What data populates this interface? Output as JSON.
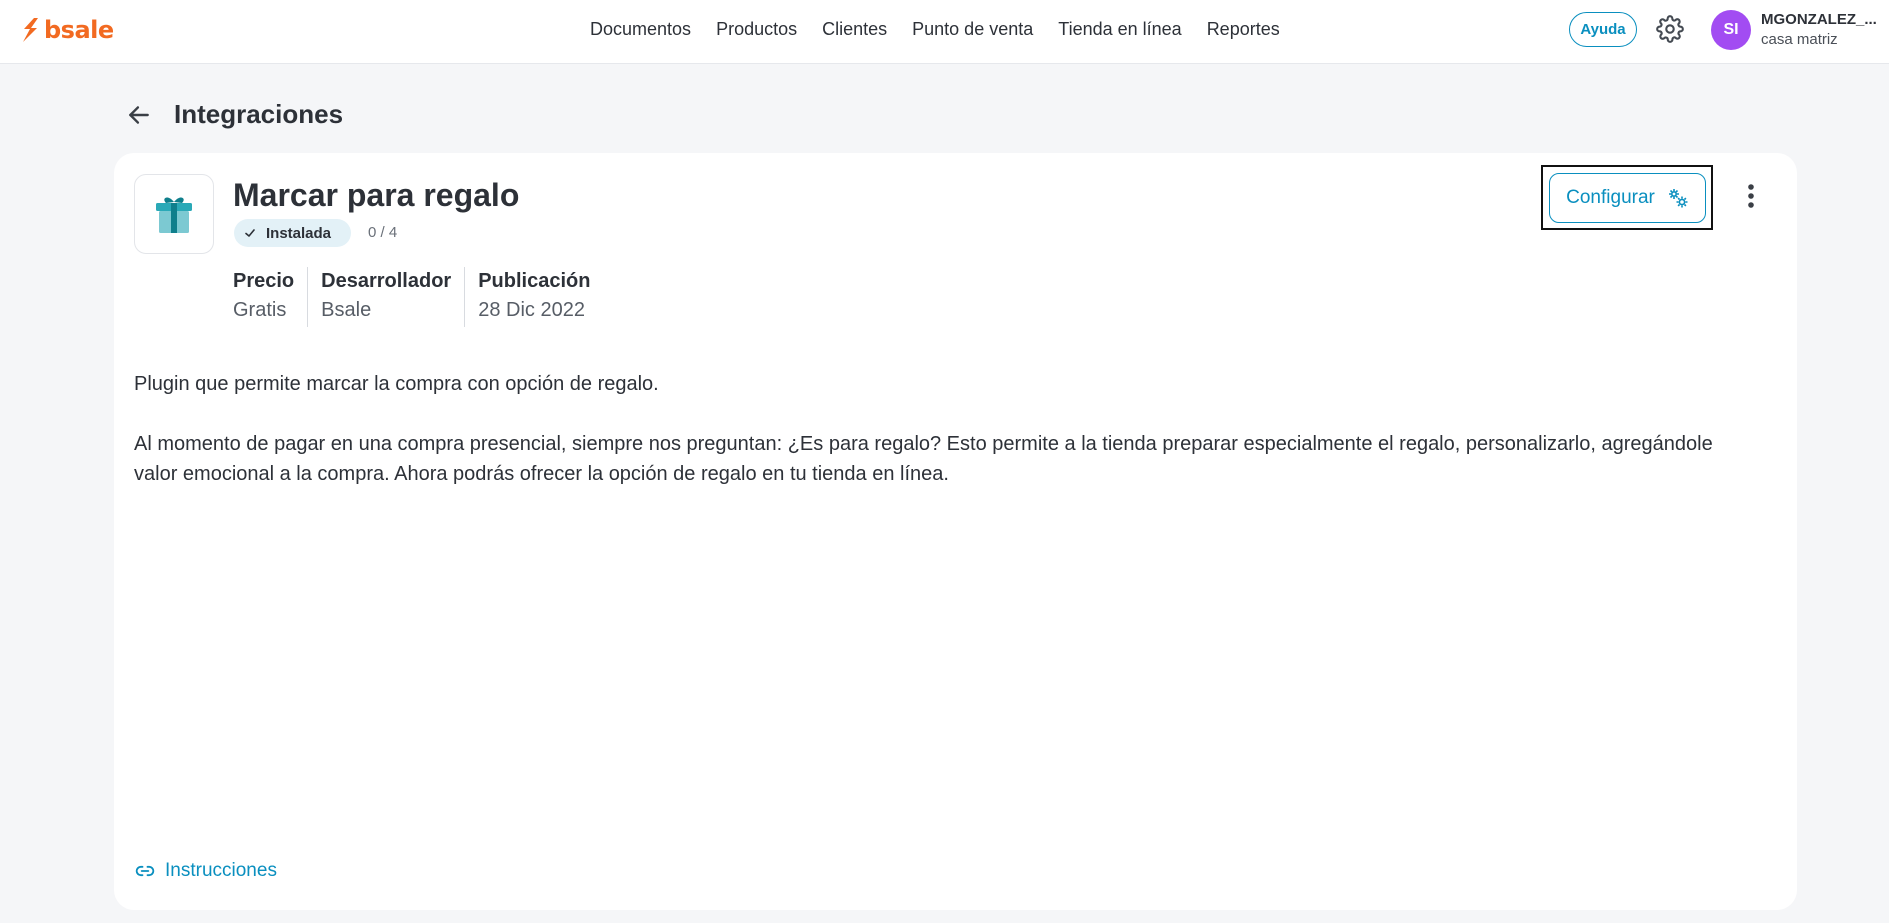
{
  "brand": {
    "name": "bsale",
    "color": "#f26a21"
  },
  "nav": {
    "items": [
      {
        "label": "Documentos"
      },
      {
        "label": "Productos"
      },
      {
        "label": "Clientes"
      },
      {
        "label": "Punto de venta"
      },
      {
        "label": "Tienda en línea"
      },
      {
        "label": "Reportes"
      }
    ]
  },
  "header": {
    "help_label": "Ayuda",
    "avatar_initials": "SI",
    "user_name": "MGONZALEZ_...",
    "user_branch": "casa matriz",
    "avatar_color": "#a24cf2"
  },
  "page": {
    "title": "Integraciones"
  },
  "integration": {
    "title": "Marcar para regalo",
    "status": "Instalada",
    "count": "0 / 4",
    "meta": {
      "price_label": "Precio",
      "price_value": "Gratis",
      "developer_label": "Desarrollador",
      "developer_value": "Bsale",
      "published_label": "Publicación",
      "published_value": "28 Dic 2022"
    },
    "description": [
      "Plugin que permite marcar la compra con opción de regalo.",
      "Al momento de pagar en una compra presencial, siempre nos preguntan: ¿Es para regalo? Esto permite a la tienda preparar especialmente el regalo, personalizarlo, agregándole valor emocional a la compra. Ahora podrás ofrecer la opción de regalo en tu tienda en línea."
    ],
    "configure_label": "Configurar",
    "instructions_label": "Instrucciones"
  },
  "colors": {
    "accent": "#0a8fbf",
    "badge_bg": "#e3f1f7",
    "page_bg": "#f5f6f8"
  },
  "icons": {
    "logo": "bsale-logo-icon",
    "help": "help-button",
    "settings": "gear-icon",
    "back": "arrow-left-icon",
    "app": "gift-icon",
    "check": "check-icon",
    "configure": "gears-icon",
    "more": "kebab-menu-icon",
    "link": "link-icon"
  }
}
